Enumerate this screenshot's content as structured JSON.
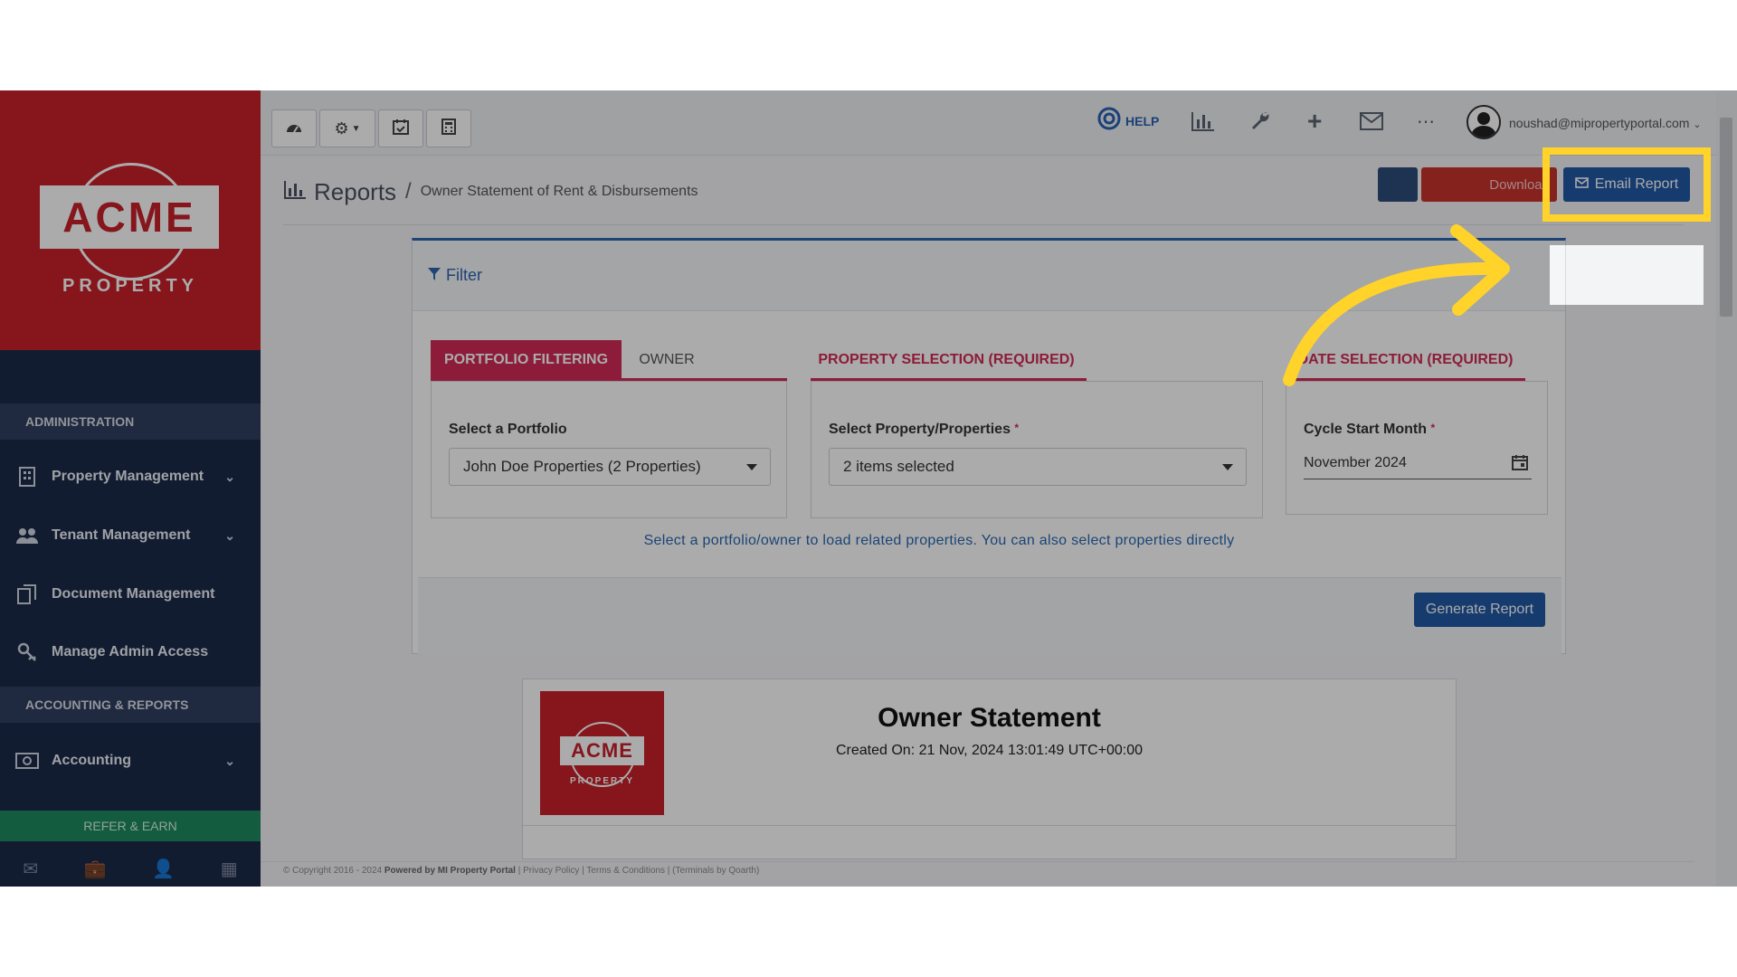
{
  "sidebar": {
    "logo_text": "ACME",
    "logo_sub": "PROPERTY",
    "sections": [
      {
        "header": "ADMINISTRATION"
      },
      {
        "header": "ACCOUNTING & REPORTS"
      }
    ],
    "items": [
      {
        "label": "Property Management",
        "icon": "building-icon",
        "has_chevron": true
      },
      {
        "label": "Tenant Management",
        "icon": "users-icon",
        "has_chevron": true
      },
      {
        "label": "Document Management",
        "icon": "documents-icon",
        "has_chevron": false
      },
      {
        "label": "Manage Admin Access",
        "icon": "key-icon",
        "has_chevron": false
      },
      {
        "label": "Accounting",
        "icon": "money-icon",
        "has_chevron": true
      }
    ],
    "refer_label": "REFER & EARN",
    "bottom_icons": [
      "envelope-icon",
      "briefcase-icon",
      "user-icon",
      "calculator-icon"
    ]
  },
  "topbar": {
    "left_buttons": [
      "dashboard-icon",
      "settings-dropdown-icon",
      "calendar-check-icon",
      "calculator-icon"
    ],
    "help_label": "HELP",
    "right_icons": [
      "chart-icon",
      "wrench-icon",
      "plus-icon",
      "envelope-icon",
      "more-icon"
    ],
    "user_email": "noushad@mipropertyportal.com"
  },
  "page": {
    "title": "Reports",
    "separator": "/",
    "report_name": "Owner Statement of Rent & Disbursements",
    "download_label": "Download",
    "email_label": "Email Report"
  },
  "filter": {
    "title": "Filter",
    "tabs": {
      "portfolio": "PORTFOLIO FILTERING",
      "owner": "OWNER",
      "property": "PROPERTY SELECTION (REQUIRED)",
      "date": "DATE SELECTION (REQUIRED)"
    },
    "portfolio_label": "Select a Portfolio",
    "portfolio_value": "John Doe Properties (2 Properties)",
    "property_label": "Select Property/Properties",
    "property_value": "2 items selected",
    "required_mark": "*",
    "date_label": "Cycle Start Month",
    "date_value": "November 2024",
    "hint": "Select a portfolio/owner to load related properties. You can also select properties directly",
    "generate_label": "Generate Report"
  },
  "statement": {
    "title": "Owner Statement",
    "created": "Created On: 21 Nov, 2024 13:01:49 UTC+00:00",
    "logo_text": "ACME",
    "logo_sub": "PROPERTY"
  },
  "footer": {
    "copyright": "© Copyright 2016 - 2024",
    "powered": "Powered by MI Property Portal",
    "links": "| Privacy Policy | Terms & Conditions |",
    "terminals": "(Terminals by Qoarth)"
  },
  "colors": {
    "brand_red": "#c8202a",
    "sidebar_navy": "#1c2a4a",
    "primary_blue": "#2159a6",
    "tab_pink": "#d12a56",
    "highlight_yellow": "#ffd32a"
  }
}
